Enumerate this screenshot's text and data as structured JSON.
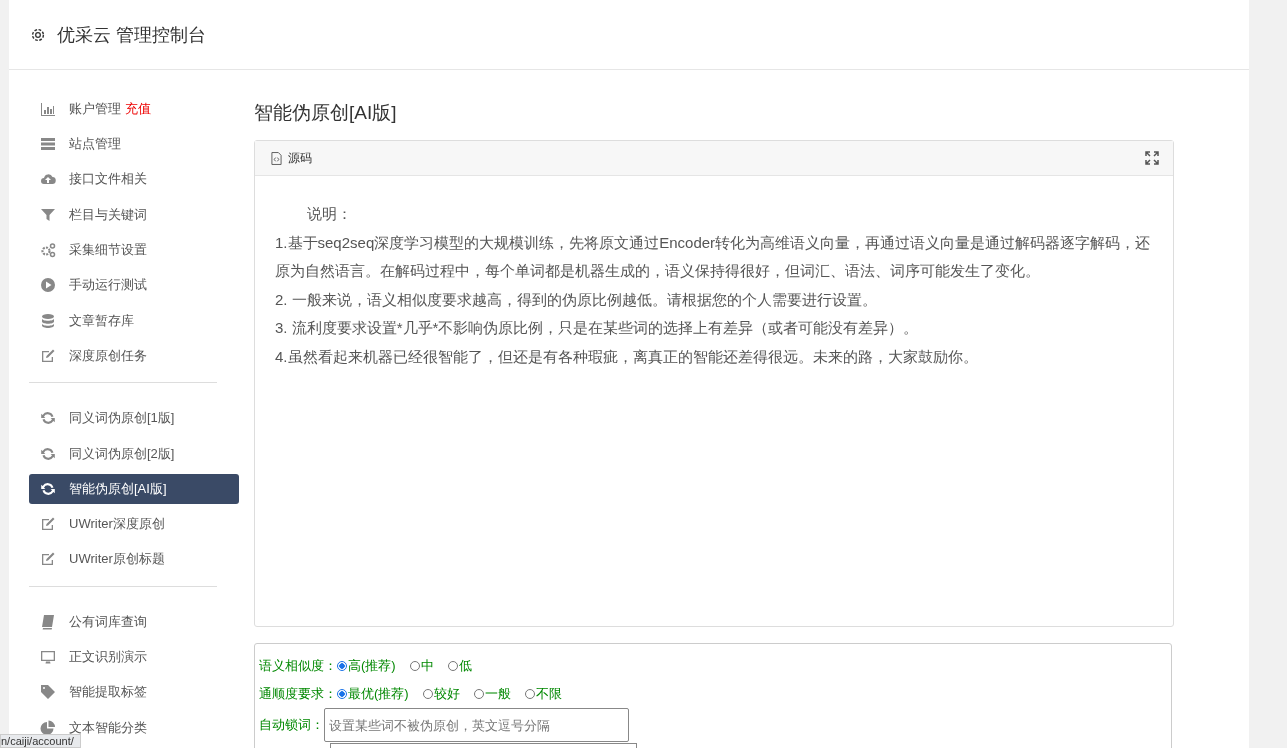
{
  "header": {
    "title": "优采云 管理控制台"
  },
  "sidebar": {
    "groups": [
      {
        "items": [
          {
            "label": "账户管理",
            "badge": "充值",
            "selected": false
          },
          {
            "label": "站点管理",
            "selected": false
          },
          {
            "label": "接口文件相关",
            "selected": false
          },
          {
            "label": "栏目与关键词",
            "selected": false
          },
          {
            "label": "采集细节设置",
            "selected": false
          },
          {
            "label": "手动运行测试",
            "selected": false
          },
          {
            "label": "文章暂存库",
            "selected": false
          },
          {
            "label": "深度原创任务",
            "selected": false
          }
        ]
      },
      {
        "items": [
          {
            "label": "同义词伪原创[1版]",
            "selected": false
          },
          {
            "label": "同义词伪原创[2版]",
            "selected": false
          },
          {
            "label": "智能伪原创[AI版]",
            "selected": true
          },
          {
            "label": "UWriter深度原创",
            "selected": false
          },
          {
            "label": "UWriter原创标题",
            "selected": false
          }
        ]
      },
      {
        "items": [
          {
            "label": "公有词库查询",
            "selected": false
          },
          {
            "label": "正文识别演示",
            "selected": false
          },
          {
            "label": "智能提取标签",
            "selected": false
          },
          {
            "label": "文本智能分类",
            "selected": false
          }
        ]
      }
    ]
  },
  "page_title": "智能伪原创[AI版]",
  "editor": {
    "toolbar_label": "源码",
    "heading": "说明：",
    "paragraphs": [
      "1.基于seq2seq深度学习模型的大规模训练，先将原文通过Encoder转化为高维语义向量，再通过语义向量是通过解码器逐字解码，还原为自然语言。在解码过程中，每个单词都是机器生成的，语义保持得很好，但词汇、语法、词序可能发生了变化。",
      "2. 一般来说，语义相似度要求越高，得到的伪原比例越低。请根据您的个人需要进行设置。",
      "3. 流利度要求设置*几乎*不影响伪原比例，只是在某些词的选择上有差异（或者可能没有差异）。",
      "4.虽然看起来机器已经很智能了，但还是有各种瑕疵，离真正的智能还差得很远。未来的路，大家鼓励你。"
    ]
  },
  "options": [
    {
      "label": "语义相似度：",
      "choices": [
        {
          "label": "高(推荐)",
          "selected": true
        },
        {
          "label": "中",
          "selected": false
        },
        {
          "label": "低",
          "selected": false
        }
      ]
    },
    {
      "label": "通顺度要求：",
      "choices": [
        {
          "label": "最优(推荐)",
          "selected": true
        },
        {
          "label": "较好",
          "selected": false
        },
        {
          "label": "一般",
          "selected": false
        },
        {
          "label": "不限",
          "selected": false
        }
      ]
    }
  ],
  "lock_words": {
    "label": "自动锁词：",
    "placeholder": "设置某些词不被伪原创，英文逗号分隔"
  },
  "status_url": "n/caiji/account/"
}
